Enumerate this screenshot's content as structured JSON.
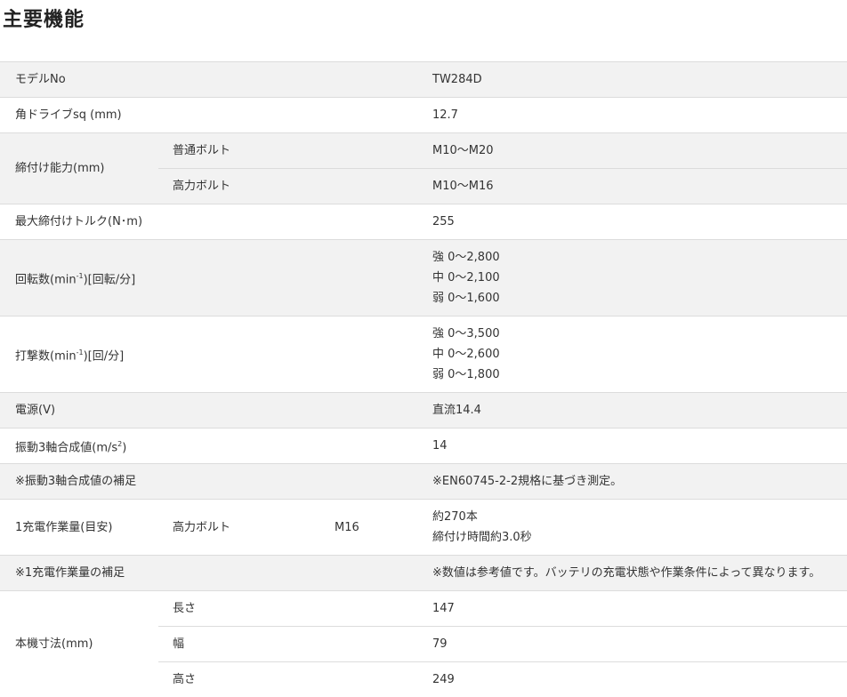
{
  "page": {
    "title": "主要機能"
  },
  "specs": {
    "model": {
      "label": "モデルNo",
      "value": "TW284D"
    },
    "drive": {
      "label": "角ドライブsq (mm)",
      "value": "12.7"
    },
    "capacity": {
      "label": "締付け能力(mm)",
      "normal": {
        "label": "普通ボルト",
        "value": "M10～M20"
      },
      "high": {
        "label": "高力ボルト",
        "value": "M10～M16"
      }
    },
    "torque": {
      "label": "最大締付けトルク(N･m)",
      "value": "255"
    },
    "rotation": {
      "label_pre": "回転数(min",
      "label_sup": "-1",
      "label_post": ")[回転/分]",
      "lines": [
        "強 0～2,800",
        "中 0～2,100",
        "弱 0～1,600"
      ]
    },
    "impact": {
      "label_pre": "打撃数(min",
      "label_sup": "-1",
      "label_post": ")[回/分]",
      "lines": [
        "強 0～3,500",
        "中 0～2,600",
        "弱 0～1,800"
      ]
    },
    "power": {
      "label": "電源(V)",
      "value": "直流14.4"
    },
    "vibration": {
      "label_pre": "振動3軸合成値(m/s",
      "label_sup": "2",
      "label_post": ")",
      "value": "14"
    },
    "vibration_note": {
      "label": "※振動3軸合成値の補足",
      "value": "※EN60745-2-2規格に基づき測定。"
    },
    "work": {
      "label": "1充電作業量(目安)",
      "bolt": "高力ボルト",
      "size": "M16",
      "lines": [
        "約270本",
        "締付け時間約3.0秒"
      ]
    },
    "work_note": {
      "label": "※1充電作業量の補足",
      "value": "※数値は参考値です。バッテリの充電状態や作業条件によって異なります。"
    },
    "dimensions": {
      "label": "本機寸法(mm)",
      "length": {
        "label": "長さ",
        "value": "147"
      },
      "width": {
        "label": "幅",
        "value": "79"
      },
      "height": {
        "label": "高さ",
        "value": "249"
      }
    }
  }
}
